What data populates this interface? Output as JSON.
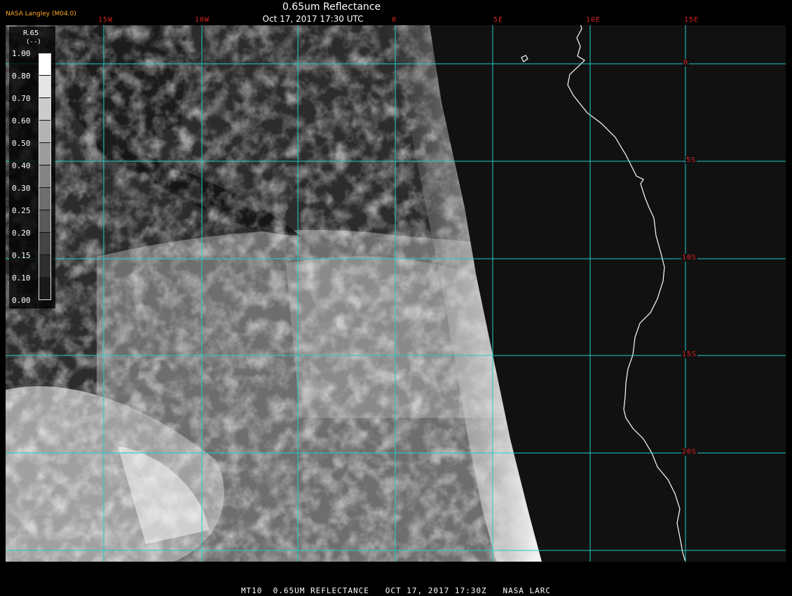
{
  "header": {
    "title": "0.65um Reflectance",
    "time": "Oct 17, 2017 17:30 UTC",
    "provider": "NASA Langley (M04.0)"
  },
  "longitude_labels": [
    "15W",
    "10W",
    "0",
    "5E",
    "10E",
    "15E"
  ],
  "latitude_labels": [
    "0",
    "5S",
    "10S",
    "15S",
    "20S"
  ],
  "legend": {
    "variable": "R.65",
    "unit": "(--)",
    "ticks": [
      "1.00",
      "0.80",
      "0.70",
      "0.60",
      "0.50",
      "0.40",
      "0.30",
      "0.25",
      "0.20",
      "0.15",
      "0.10",
      "0.00"
    ]
  },
  "footer": "MT10  0.65UM REFLECTANCE   OCT 17, 2017 17:30Z   NASA LARC",
  "colors": {
    "grid": "#22cccc",
    "labels": "#dd2222",
    "coastline": "#ffffff",
    "provider": "#ffaa22"
  }
}
